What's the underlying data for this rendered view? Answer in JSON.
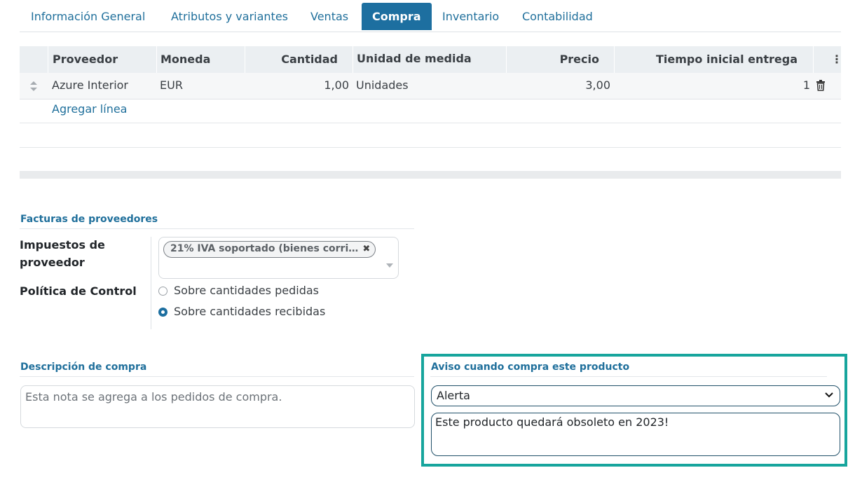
{
  "tabs": [
    {
      "label": "Información General"
    },
    {
      "label": "Atributos y variantes"
    },
    {
      "label": "Ventas"
    },
    {
      "label": "Compra"
    },
    {
      "label": "Inventario"
    },
    {
      "label": "Contabilidad"
    }
  ],
  "active_tab": "Compra",
  "vendors_table": {
    "columns": [
      "Proveedor",
      "Moneda",
      "Cantidad",
      "Unidad de medida",
      "Precio",
      "Tiempo inicial entrega"
    ],
    "rows": [
      {
        "proveedor": "Azure Interior",
        "moneda": "EUR",
        "cantidad": "1,00",
        "unidad": "Unidades",
        "precio": "3,00",
        "tiempo": "1"
      }
    ],
    "add_line": "Agregar línea",
    "menu_icon": "vertical-dots-icon",
    "row_icons": [
      "drag-handle-icon",
      "trash-icon"
    ]
  },
  "vendor_bills": {
    "title": "Facturas de proveedores",
    "taxes_label": "Impuestos de proveedor",
    "tax_tag": "21% IVA soportado (bienes corri…",
    "control_label": "Política de Control",
    "control_options": [
      {
        "label": "Sobre cantidades pedidas",
        "checked": false
      },
      {
        "label": "Sobre cantidades recibidas",
        "checked": true
      }
    ]
  },
  "purchase_description": {
    "title": "Descripción de compra",
    "placeholder": "Esta nota se agrega a los pedidos de compra."
  },
  "purchase_warning": {
    "title": "Aviso cuando compra este producto",
    "selected": "Alerta",
    "message": "Este producto quedará obsoleto en 2023!"
  },
  "colors": {
    "accent": "#1d6fa0",
    "link": "#1f6f9b",
    "highlight": "#17a59d"
  }
}
